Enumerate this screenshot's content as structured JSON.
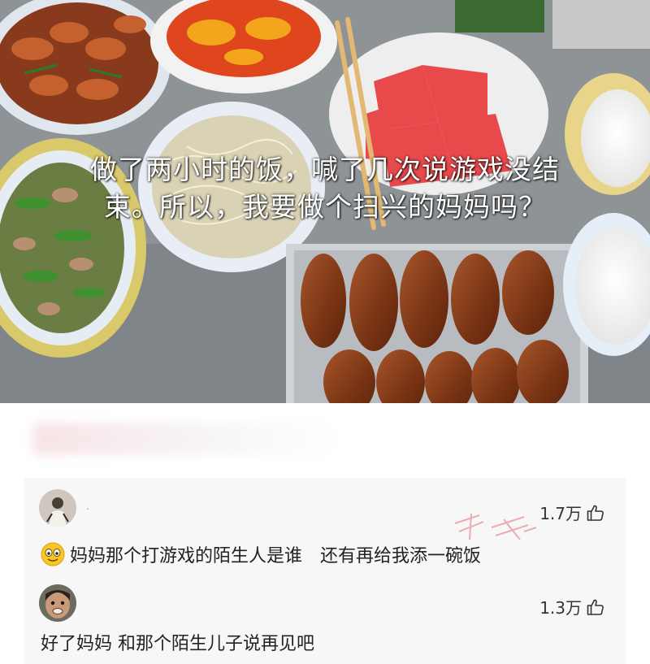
{
  "post": {
    "caption_line1": "做了两小时的饭，喊了几次说游戏没结",
    "caption_line2": "束。所以，我要做个扫兴的妈妈吗？"
  },
  "comments": [
    {
      "username": ".",
      "likes": "1.7万",
      "text": "妈妈那个打游戏的陌生人是谁　还有再给我添一碗饭",
      "emoji": "smiling-face-emoji"
    },
    {
      "username": "",
      "likes": "1.3万",
      "text": "好了妈妈 和那个陌生儿子说再见吧"
    }
  ],
  "icons": {
    "like": "thumbs-up-icon"
  },
  "colors": {
    "caption_text": "#ffffff",
    "comment_bg": "#f7f7f7",
    "watermark": "#e8a0a8"
  }
}
